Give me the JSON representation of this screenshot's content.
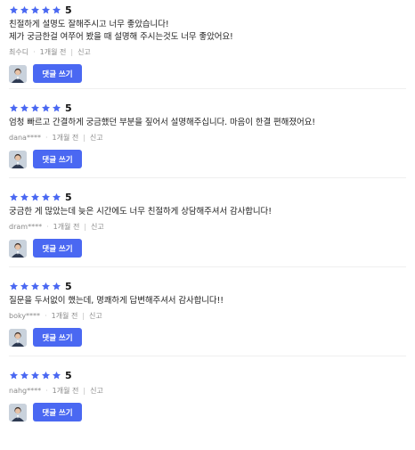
{
  "colors": {
    "star": "#4a68f2",
    "button": "#4a68f2",
    "meta": "#8a8a8a"
  },
  "icons": {
    "star": "star-icon",
    "avatar": "user-avatar"
  },
  "reviews": [
    {
      "score": "5",
      "stars": 5,
      "text": "친절하게 설명도 잘해주시고 너무 좋았습니다!\n제가 궁금한걸 여쭈어 봤을 때 설명해 주시는것도 너무 좋았어요!",
      "author": "최수디",
      "date": "1개월 전",
      "report": "신고",
      "reply_label": "댓글 쓰기"
    },
    {
      "score": "5",
      "stars": 5,
      "text": "엄청 빠르고 간결하게 궁금했던 부분을 짚어서 설명해주십니다. 마음이 한결 편해졌어요!",
      "author": "dana****",
      "date": "1개월 전",
      "report": "신고",
      "reply_label": "댓글 쓰기"
    },
    {
      "score": "5",
      "stars": 5,
      "text": "궁금한 게 많았는데 늦은 시간에도 너무 친절하게 상담해주셔서 감사합니다!",
      "author": "dram****",
      "date": "1개월 전",
      "report": "신고",
      "reply_label": "댓글 쓰기"
    },
    {
      "score": "5",
      "stars": 5,
      "text": "질문을 두서없이 했는데, 명쾌하게 답변해주셔서 감사합니다!!",
      "author": "boky****",
      "date": "1개월 전",
      "report": "신고",
      "reply_label": "댓글 쓰기"
    },
    {
      "score": "5",
      "stars": 5,
      "text": "",
      "author": "nahg****",
      "date": "1개월 전",
      "report": "신고",
      "reply_label": "댓글 쓰기"
    }
  ]
}
